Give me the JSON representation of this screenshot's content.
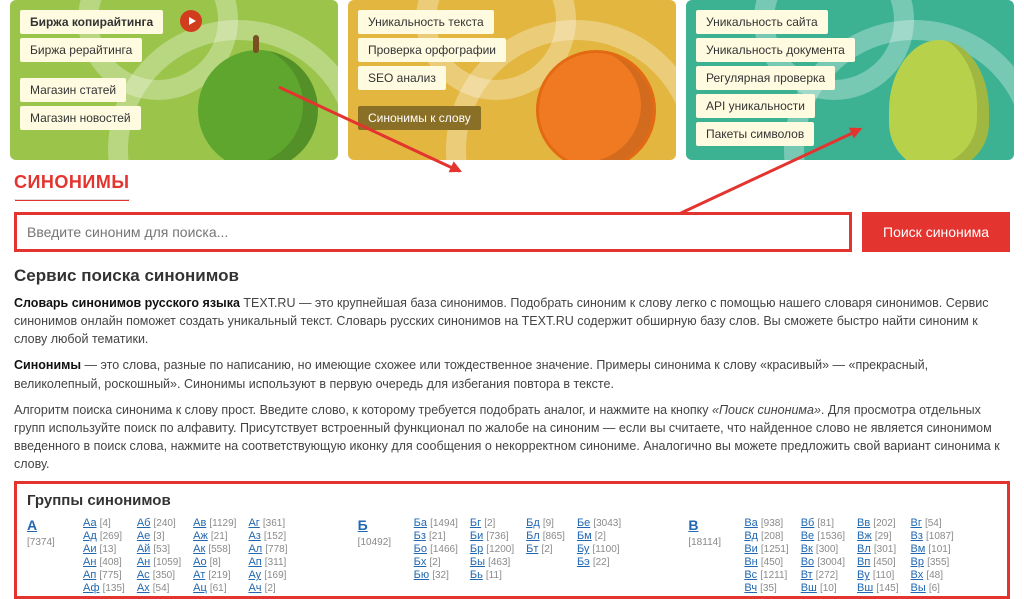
{
  "cards": {
    "green": [
      "Биржа копирайтинга",
      "Биржа рерайтинга",
      "Магазин статей",
      "Магазин новостей"
    ],
    "yellow": [
      "Уникальность текста",
      "Проверка орфографии",
      "SEO анализ",
      "Синонимы к слову"
    ],
    "teal": [
      "Уникальность сайта",
      "Уникальность документа",
      "Регулярная проверка",
      "API уникальности",
      "Пакеты символов"
    ]
  },
  "heading": "СИНОНИМЫ",
  "search": {
    "placeholder": "Введите синоним для поиска...",
    "button": "Поиск синонима"
  },
  "sub1": "Сервис поиска синонимов",
  "para1_bold": "Словарь синонимов русского языка",
  "para1_rest": " TEXT.RU — это крупнейшая база синонимов. Подобрать синоним к слову легко с помощью нашего словаря синонимов. Сервис синонимов онлайн поможет создать уникальный текст. Словарь русских синонимов на TEXT.RU содержит обширную базу слов. Вы сможете быстро найти синоним к слову любой тематики.",
  "para2_bold": "Синонимы",
  "para2_rest": " — это слова, разные по написанию, но имеющие схожее или тождественное значение. Примеры синонима к слову «красивый» — «прекрасный, великолепный, роскошный». Синонимы используют в первую очередь для избегания повтора в тексте.",
  "para3_a": "Алгоритм поиска синонима к слову прост. Введите слово, к которому требуется подобрать аналог, и нажмите на кнопку ",
  "para3_i": "«Поиск синонима»",
  "para3_b": ". Для просмотра отдельных групп используйте поиск по алфавиту. Присутствует встроенный функционал по жалобе на синоним — если вы считаете, что найденное слово не является синонимом введенного в поиск слова, нажмите на соответствующую иконку для сообщения о некорректном синониме. Аналогично вы можете предложить свой вариант синонима к слову.",
  "groups_title": "Группы синонимов",
  "letters": {
    "A": {
      "label": "А",
      "count": "[7374]",
      "cols": [
        [
          [
            "Аа",
            "4"
          ],
          [
            "Ад",
            "269"
          ],
          [
            "Аи",
            "13"
          ],
          [
            "Ан",
            "408"
          ],
          [
            "Ап",
            "775"
          ],
          [
            "Аф",
            "135"
          ]
        ],
        [
          [
            "Аб",
            "240"
          ],
          [
            "Ае",
            "3"
          ],
          [
            "Ай",
            "53"
          ],
          [
            "Ан",
            "1059"
          ],
          [
            "Ас",
            "350"
          ],
          [
            "Ах",
            "54"
          ]
        ],
        [
          [
            "Ав",
            "1129"
          ],
          [
            "Аж",
            "21"
          ],
          [
            "Ак",
            "558"
          ],
          [
            "Ао",
            "8"
          ],
          [
            "Ат",
            "219"
          ],
          [
            "Ац",
            "61"
          ]
        ],
        [
          [
            "Аг",
            "361"
          ],
          [
            "Аз",
            "152"
          ],
          [
            "Ал",
            "778"
          ],
          [
            "Ап",
            "311"
          ],
          [
            "Ау",
            "169"
          ],
          [
            "Ач",
            "2"
          ]
        ]
      ]
    },
    "B": {
      "label": "Б",
      "count": "[10492]",
      "cols": [
        [
          [
            "Ба",
            "1494"
          ],
          [
            "Бз",
            "21"
          ],
          [
            "Бо",
            "1466"
          ],
          [
            "Бх",
            "2"
          ],
          [
            "Бю",
            "32"
          ]
        ],
        [
          [
            "Бг",
            "2"
          ],
          [
            "Би",
            "736"
          ],
          [
            "Бр",
            "1200"
          ],
          [
            "Бы",
            "463"
          ],
          [
            "Бь",
            "11"
          ]
        ],
        [
          [
            "Бд",
            "9"
          ],
          [
            "Бл",
            "865"
          ],
          [
            "Бт",
            "2"
          ]
        ],
        [
          [
            "Бе",
            "3043"
          ],
          [
            "Бм",
            "2"
          ],
          [
            "Бу",
            "1100"
          ],
          [
            "Бэ",
            "22"
          ]
        ]
      ]
    },
    "V": {
      "label": "В",
      "count": "[18114]",
      "cols": [
        [
          [
            "Ва",
            "938"
          ],
          [
            "Вд",
            "208"
          ],
          [
            "Ви",
            "1251"
          ],
          [
            "Вн",
            "450"
          ],
          [
            "Вс",
            "1211"
          ],
          [
            "Вч",
            "35"
          ]
        ],
        [
          [
            "Вб",
            "81"
          ],
          [
            "Ве",
            "1536"
          ],
          [
            "Вк",
            "300"
          ],
          [
            "Во",
            "3004"
          ],
          [
            "Вт",
            "272"
          ],
          [
            "Вш",
            "10"
          ]
        ],
        [
          [
            "Вв",
            "202"
          ],
          [
            "Вж",
            "29"
          ],
          [
            "Вл",
            "301"
          ],
          [
            "Вп",
            "450"
          ],
          [
            "Ву",
            "110"
          ],
          [
            "Вш",
            "145"
          ]
        ],
        [
          [
            "Вг",
            "54"
          ],
          [
            "Вз",
            "1087"
          ],
          [
            "Вм",
            "101"
          ],
          [
            "Вр",
            "355"
          ],
          [
            "Вх",
            "48"
          ],
          [
            "Вы",
            "6"
          ]
        ]
      ]
    }
  }
}
